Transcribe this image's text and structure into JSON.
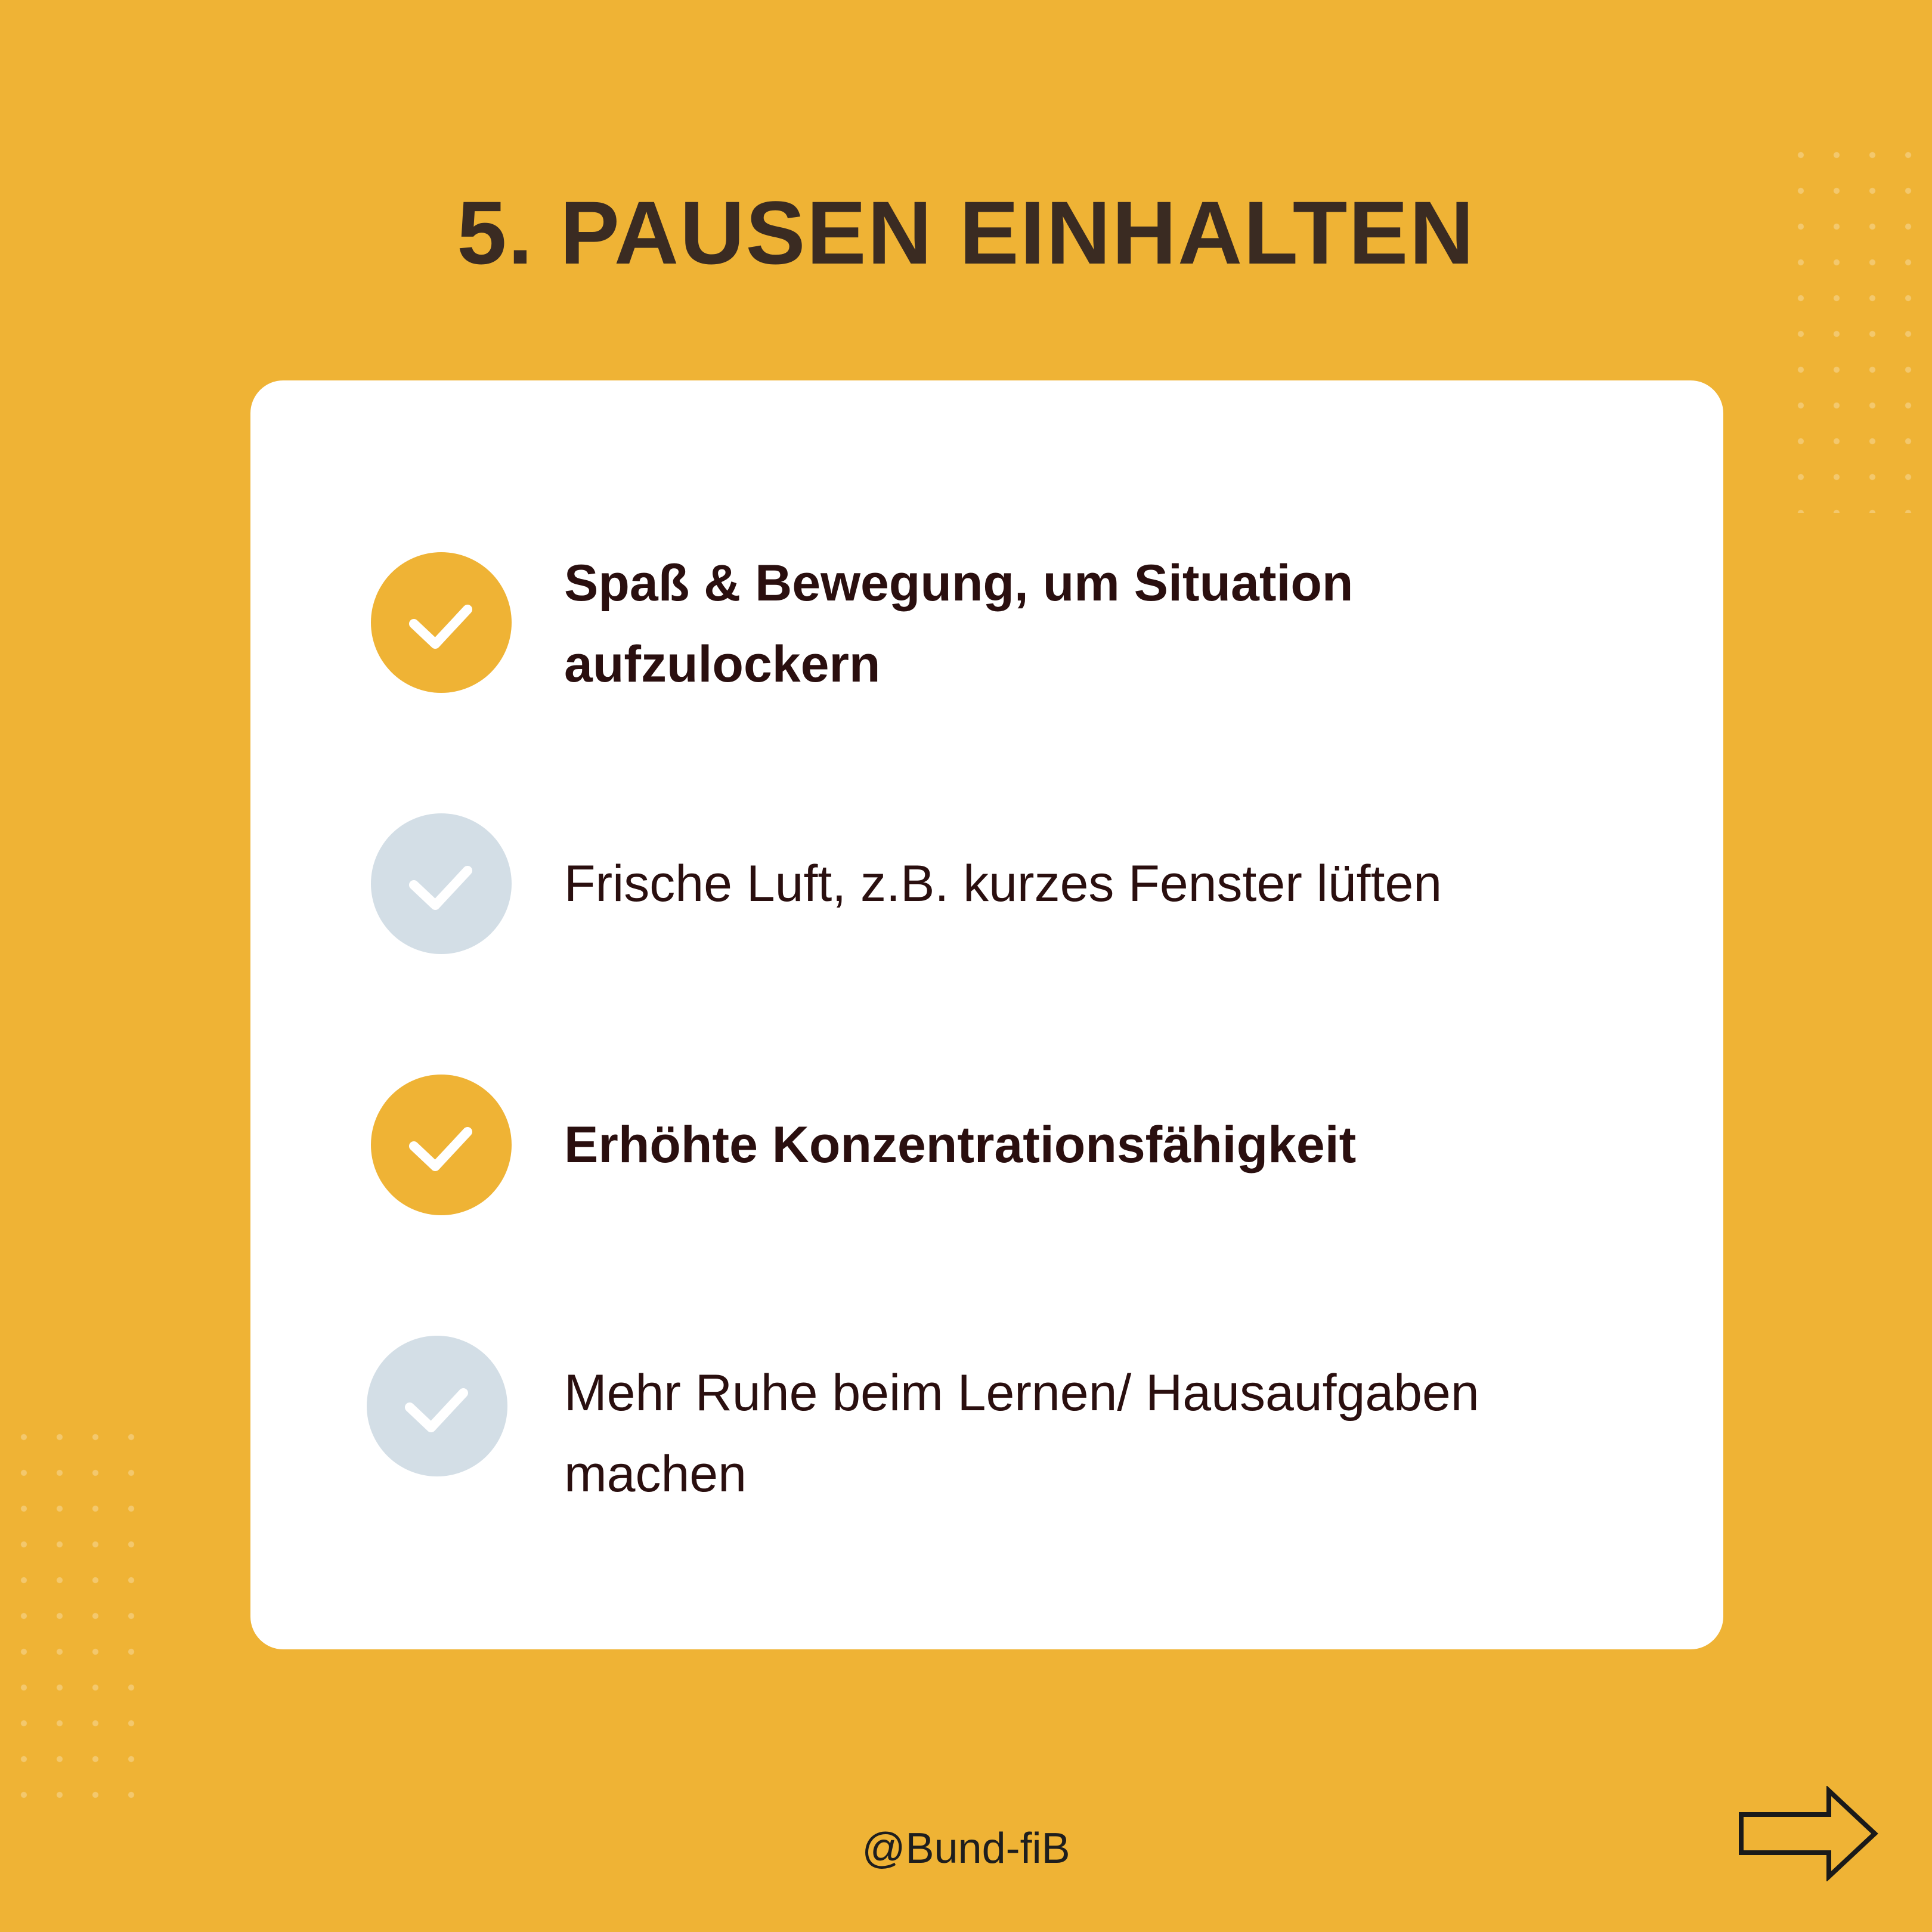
{
  "title": "5. PAUSEN EINHALTEN",
  "items": [
    {
      "text": "Spaß & Bewegung, um Situation aufzulockern",
      "style": "accent",
      "bold": true
    },
    {
      "text": "Frische Luft, z.B. kurzes Fenster lüften",
      "style": "muted",
      "bold": false
    },
    {
      "text": "Erhöhte Konzentrationsfähigkeit",
      "style": "accent",
      "bold": true
    },
    {
      "text": "Mehr Ruhe beim Lernen/ Hausaufgaben machen",
      "style": "muted",
      "bold": false
    }
  ],
  "footer": {
    "handle": "@Bund-fiB"
  },
  "icons": {
    "check": "check-icon",
    "next": "arrow-right-icon"
  },
  "colors": {
    "background": "#EFB335",
    "card": "#FFFFFF",
    "accent_circle": "#EFB335",
    "muted_circle": "#D3DEE6",
    "title": "#3A2B22",
    "text": "#2A0F0F"
  }
}
